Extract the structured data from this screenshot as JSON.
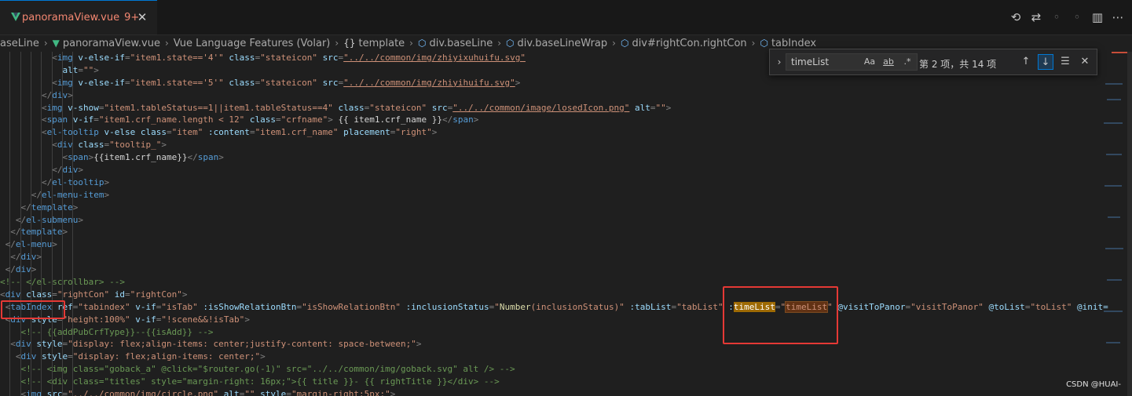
{
  "tab": {
    "name": "panoramaView.vue",
    "badge": "9+",
    "close": "✕"
  },
  "breadcrumb": {
    "items": [
      "aseLine",
      "panoramaView.vue",
      "Vue Language Features (Volar)",
      "template",
      "div.baseLine",
      "div.baseLineWrap",
      "div#rightCon.rightCon",
      "tabIndex"
    ],
    "separator": "›"
  },
  "find": {
    "value": "timeList",
    "count": "第 2 项，共 14 项",
    "opt_case": "Aa",
    "opt_word": "ab",
    "opt_regex": ".*"
  },
  "code": {
    "l1": {
      "pre": "          ",
      "tag": "img",
      "a1": " v-else-if",
      "v1": "\"item1.state=='4'\"",
      "a2": " class",
      "v2": "\"stateicon\"",
      "a3": " src",
      "v3": "\"../../common/img/zhiyixuhuifu.svg\""
    },
    "l2": {
      "pre": "            ",
      "a1": "alt",
      "v1": "\"\""
    },
    "l3": {
      "pre": "          ",
      "tag": "img",
      "a1": " v-else-if",
      "v1": "\"item1.state=='5'\"",
      "a2": " class",
      "v2": "\"stateicon\"",
      "a3": " src",
      "v3": "\"../../common/img/zhiyihuifu.svg\""
    },
    "l4": {
      "pre": "        ",
      "tag": "div"
    },
    "l5": {
      "pre": "        ",
      "tag": "img",
      "a1": " v-show",
      "v1": "\"item1.tableStatus==1||item1.tableStatus==4\"",
      "a2": " class",
      "v2": "\"stateicon\"",
      "a3": " src",
      "v3": "\"../../common/image/losedIcon.png\"",
      "a4": " alt",
      "v4": "\"\""
    },
    "l6": {
      "pre": "        ",
      "tag": "span",
      "a1": " v-if",
      "v1": "\"item1.crf_name.length < 12\"",
      "a2": " class",
      "v2": "\"crfname\"",
      "txt": " {{ item1.crf_name }}",
      "etag": "span"
    },
    "l7": {
      "pre": "        ",
      "tag": "el-tooltip",
      "a1": " v-else",
      "a2": " class",
      "v2": "\"item\"",
      "a3": " :content",
      "v3": "\"item1.crf_name\"",
      "a4": " placement",
      "v4": "\"right\""
    },
    "l8": {
      "pre": "          ",
      "tag": "div",
      "a1": " class",
      "v1": "\"tooltip_\""
    },
    "l9": {
      "pre": "            ",
      "tag": "span",
      "txt": "{{item1.crf_name}}",
      "etag": "span"
    },
    "l10": {
      "pre": "          ",
      "tag": "div"
    },
    "l11": {
      "pre": "        ",
      "tag": "el-tooltip"
    },
    "l12": {
      "pre": "      ",
      "tag": "el-menu-item"
    },
    "l13": {
      "pre": "    ",
      "tag": "template"
    },
    "l14": {
      "pre": "   ",
      "tag": "el-submenu"
    },
    "l15": {
      "pre": "  ",
      "tag": "template"
    },
    "l16": {
      "pre": " ",
      "tag": "el-menu"
    },
    "l17": {
      "pre": "  ",
      "tag": "div"
    },
    "l18": {
      "pre": " ",
      "tag": "div"
    },
    "l19": {
      "cm": "<!-- </el-scrollbar> -->"
    },
    "l20": {
      "tag": "div",
      "a1": " class",
      "v1": "\"rightCon\"",
      "a2": " id",
      "v2": "\"rightCon\""
    },
    "l21": {
      "pre": " ",
      "tag": "tabIndex",
      "a1": " ref",
      "v1": "\"tabindex\"",
      "a2": " v-if",
      "v2": "\"isTab\"",
      "a3": " :isShowRelationBtn",
      "v3": "\"isShowRelationBtn\"",
      "a4": " :inclusionStatus",
      "v4a": "\"",
      "fn": "Number",
      "v4b": "(inclusionStatus)\"",
      "a5": " :tabList",
      "v5": "\"tabList\"",
      "a6pre": " :",
      "m1": "timeList",
      "eq": "=",
      "q1": "\"",
      "m2": "timeList",
      "q2": "\"",
      "a7": " @visitToPanor",
      "v7": "\"visitToPanor\"",
      "a8": " @toList",
      "v8": "\"toList\"",
      "a9": " @init=",
      "v9": ""
    },
    "l22": {
      "pre": " ",
      "tag": "div",
      "a1": " style",
      "v1": "\"height:100%\"",
      "a2": " v-if",
      "v2": "\"!scene&&!isTab\""
    },
    "l23": {
      "pre": "    ",
      "cm": "<!-- {{addPubCrfType}}--{{isAdd}} -->"
    },
    "l24": {
      "pre": "  ",
      "tag": "div",
      "a1": " style",
      "v1": "\"display: flex;align-items: center;justify-content: space-between;\""
    },
    "l25": {
      "pre": "   ",
      "tag": "div",
      "a1": " style",
      "v1": "\"display: flex;align-items: center;\""
    },
    "l26": {
      "pre": "    ",
      "cm": "<!-- <img class=\"goback_a\" @click=\"$router.go(-1)\" src=\"../../common/img/goback.svg\" alt /> -->"
    },
    "l27": {
      "pre": "    ",
      "cm": "<!-- <div class=\"titles\" style=\"margin-right: 16px;\">{{ title }}- {{ rightTitle }}</div> -->"
    },
    "l28": {
      "pre": "    ",
      "tag": "img",
      "a1": " src",
      "v1": "\"../../common/img/circle.png\"",
      "a2": " alt",
      "v2": "\"\"",
      "a3": " style",
      "v3": "\"margin-right:5px;\""
    }
  },
  "watermark": "CSDN @HUAI-"
}
